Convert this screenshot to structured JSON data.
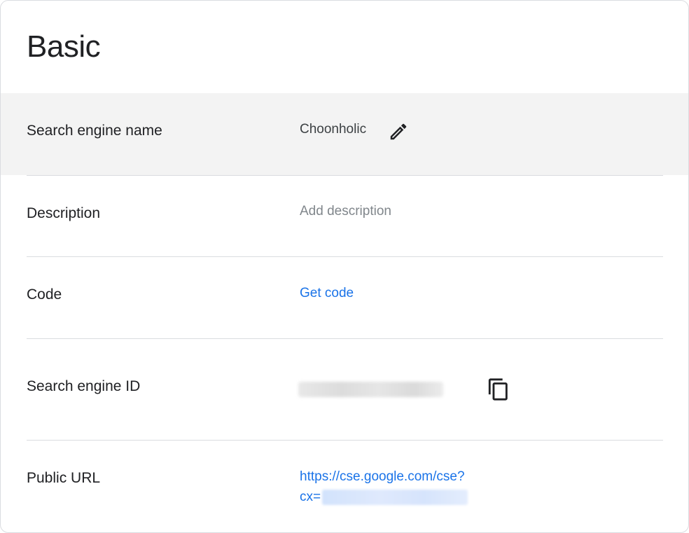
{
  "card": {
    "title": "Basic"
  },
  "rows": [
    {
      "label": "Search engine name",
      "value": "Choonholic",
      "action_icon": "pencil-edit-icon"
    },
    {
      "label": "Description",
      "placeholder": "Add description"
    },
    {
      "label": "Code",
      "link": "Get code"
    },
    {
      "label": "Search engine ID",
      "value_redacted": true,
      "action_icon": "copy-icon"
    },
    {
      "label": "Public URL",
      "url_line1": "https://cse.google.com/cse?",
      "url_line2_prefix": "cx=",
      "url_redacted": true
    }
  ],
  "colors": {
    "highlight_row": "#f3f3f3",
    "link": "#1a73e8",
    "placeholder": "#80868b",
    "divider": "#dadce0"
  }
}
